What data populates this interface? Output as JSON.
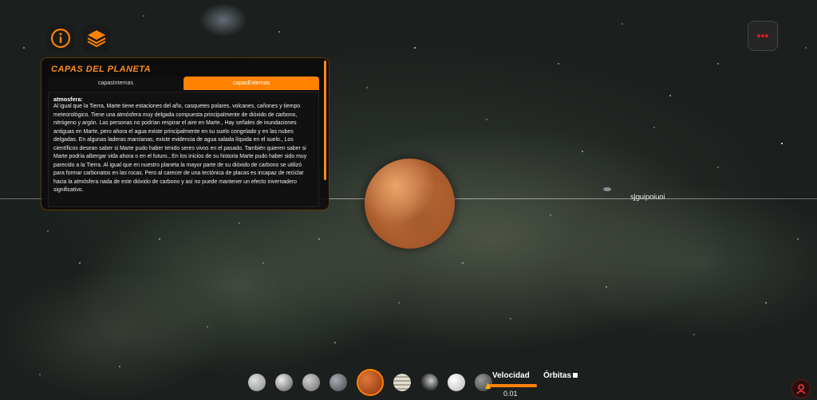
{
  "panel": {
    "title": "CAPAS DEL PLANETA",
    "tabs": [
      {
        "label": "capasInternas",
        "active": false
      },
      {
        "label": "capasExternas",
        "active": true
      }
    ],
    "section_heading": "atmosfera:",
    "section_text": "Al igual que la Tierra, Marte tiene estaciones del año, casquetes polares, volcanes, cañones y tiempo meteorológico. Tiene una atmósfera muy delgada compuesta principalmente de dióxido de carbono, nitrógeno y argón. Las personas no podrían respirar el aire en Marte., Hay señales de inundaciones antiguas en Marte, pero ahora el agua existe principalmente en su suelo congelado y en las nubes delgadas. En algunas laderas marcianas, existe evidencia de agua salada líquida en el suelo., Los científicos desean saber si Marte pudo haber tenido seres vivos en el pasado. También quieren saber si Marte podría albergar vida ahora o en el futuro., En los inicios de su historia Marte pudo haber sido muy parecido a la Tierra. Al igual que en nuestro planeta la mayor parte de su dióxido de carbono se utilizó para formar carbonatos en las rocas. Pero al carecer de una tectónica de placas es incapaz de reciclar hacia la atmósfera nada de este dióxido de carbono y así no puede mantener un efecto invernadero significativo."
  },
  "orbit_label": "sJguipoiuoi",
  "planets": [
    {
      "name": "planet-1",
      "color": "#bdbdbd"
    },
    {
      "name": "planet-2",
      "color": "#cfcfcf"
    },
    {
      "name": "planet-3",
      "color": "#a9a9a9"
    },
    {
      "name": "planet-4",
      "color": "#7b7f84"
    },
    {
      "name": "mars",
      "color": "#c0551f",
      "selected": true
    },
    {
      "name": "planet-6",
      "color": "#c8c2b4"
    },
    {
      "name": "planet-7",
      "color": "#8e8e8e"
    },
    {
      "name": "planet-8",
      "color": "#e6e6e6"
    },
    {
      "name": "planet-9",
      "color": "#6d6d6d"
    }
  ],
  "controls": {
    "velocity_label": "Velocidad",
    "velocity_value": "0.01",
    "orbits_label": "Órbitas"
  },
  "colors": {
    "accent": "#ff8200",
    "panel_bg": "#0a0a0a"
  }
}
